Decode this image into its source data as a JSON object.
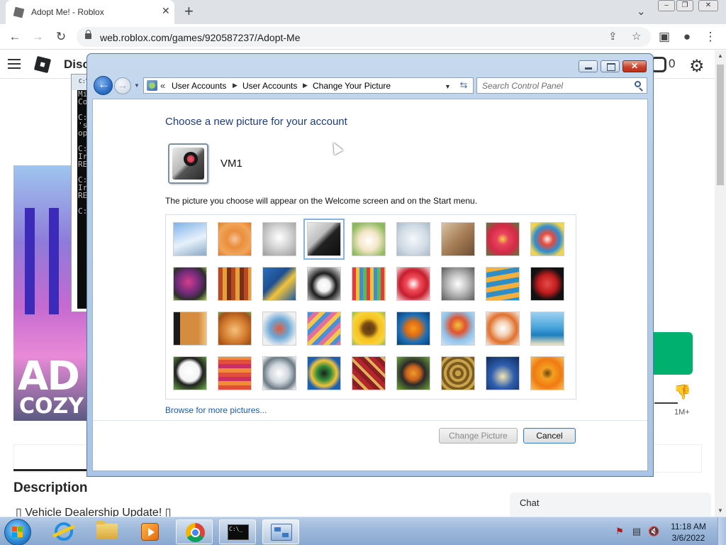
{
  "browser": {
    "tab_title": "Adopt Me! - Roblox",
    "tab_close": "✕",
    "new_tab": "+",
    "tab_menu": "⌄",
    "url": "web.roblox.com/games/920587237/Adopt-Me",
    "buttons": {
      "back": "←",
      "forward": "→",
      "reload": "↻",
      "share": "⇪",
      "bookmark": "☆",
      "sidepanel": "▣",
      "profile": "●",
      "menu": "⋮"
    },
    "window_controls": {
      "minimize": "‒",
      "restore": "❐",
      "close": "✕"
    }
  },
  "roblox": {
    "discover": "Disc",
    "robux_count": "0",
    "gear": "⚙",
    "hero_line1": "AD",
    "hero_line2": "COZY",
    "visits": "1M+",
    "dislike": "👎",
    "description_title": "Description",
    "description_text": "▯ Vehicle Dealership Update! ▯",
    "chat_label": "Chat"
  },
  "cmd_window": {
    "title_text": "C:\\",
    "lines": "Mi\nCo\n\nC:\n's\nop\n\nC:\nIr\nRE\n\nC:\nIr\nRE\n\nC:"
  },
  "control_panel": {
    "breadcrumb": {
      "overflow": "«",
      "items": [
        "User Accounts",
        "User Accounts",
        "Change Your Picture"
      ],
      "separator": "▶"
    },
    "search_placeholder": "Search Control Panel",
    "heading": "Choose a new picture for your account",
    "username": "VM1",
    "info_text": "The picture you choose will appear on the Welcome screen and on the Start menu.",
    "pictures": [
      "roller-coaster",
      "starfish",
      "robot-toy",
      "turntable",
      "lucky-cat",
      "gyroscope",
      "kitten",
      "flower",
      "ferris-wheel",
      "ball",
      "fabric",
      "leaf",
      "dog",
      "crayons",
      "star-ornament",
      "jacks",
      "stairs",
      "origami-crane",
      "guitar",
      "puppy",
      "tin-robot",
      "scarf",
      "sunflower",
      "fish",
      "hot-air-balloon",
      "kokeshi",
      "sailboat",
      "soccer-ball",
      "striped-fabric",
      "marbles",
      "window",
      "rug",
      "butterfly",
      "spiral",
      "lighthouse",
      "gerbera"
    ],
    "selected_picture": "turntable",
    "browse_link": "Browse for more pictures...",
    "change_button": "Change Picture",
    "cancel_button": "Cancel"
  },
  "taskbar": {
    "clock_time": "11:18 AM",
    "clock_date": "3/6/2022",
    "items": [
      "internet-explorer",
      "windows-explorer",
      "media-player",
      "chrome",
      "command-prompt",
      "control-panel"
    ],
    "tray": [
      "action-center-icon",
      "network-icon",
      "volume-muted-icon"
    ]
  }
}
